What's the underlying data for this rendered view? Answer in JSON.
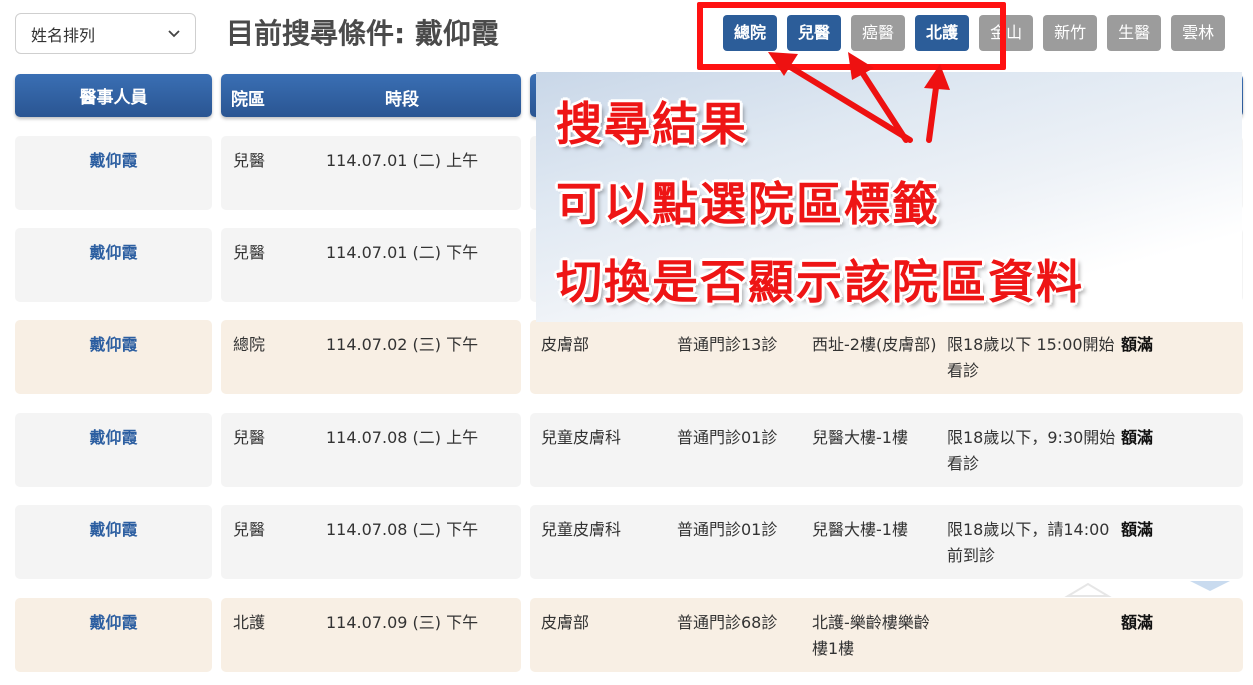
{
  "sort": {
    "label": "姓名排列"
  },
  "title": "目前搜尋條件: 戴仰霞",
  "branch_tags": [
    {
      "label": "總院",
      "active": true
    },
    {
      "label": "兒醫",
      "active": true
    },
    {
      "label": "癌醫",
      "active": false
    },
    {
      "label": "北護",
      "active": true
    },
    {
      "label": "金山",
      "active": false
    },
    {
      "label": "新竹",
      "active": false
    },
    {
      "label": "生醫",
      "active": false
    },
    {
      "label": "雲林",
      "active": false
    }
  ],
  "headers": {
    "staff": "醫事人員",
    "branch": "院區",
    "time": "時段"
  },
  "rows": [
    {
      "staff": "戴仰霞",
      "branch": "兒醫",
      "time": "114.07.01 (二) 上午",
      "dept": "",
      "clinic": "",
      "location": "",
      "note": "",
      "status": ""
    },
    {
      "staff": "戴仰霞",
      "branch": "兒醫",
      "time": "114.07.01 (二) 下午",
      "dept": "",
      "clinic": "",
      "location": "",
      "note": "",
      "status": ""
    },
    {
      "staff": "戴仰霞",
      "branch": "總院",
      "time": "114.07.02 (三) 下午",
      "dept": "皮膚部",
      "clinic": "普通門診13診",
      "location": "西址-2樓(皮膚部)",
      "note": "限18歲以下 15:00開始看診",
      "status": "額滿"
    },
    {
      "staff": "戴仰霞",
      "branch": "兒醫",
      "time": "114.07.08 (二) 上午",
      "dept": "兒童皮膚科",
      "clinic": "普通門診01診",
      "location": "兒醫大樓-1樓",
      "note": "限18歲以下，9:30開始看診",
      "status": "額滿"
    },
    {
      "staff": "戴仰霞",
      "branch": "兒醫",
      "time": "114.07.08 (二) 下午",
      "dept": "兒童皮膚科",
      "clinic": "普通門診01診",
      "location": "兒醫大樓-1樓",
      "note": "限18歲以下，請14:00前到診",
      "status": "額滿"
    },
    {
      "staff": "戴仰霞",
      "branch": "北護",
      "time": "114.07.09 (三) 下午",
      "dept": "皮膚部",
      "clinic": "普通門診68診",
      "location": "北護-樂齡樓樂齡樓1樓",
      "note": "",
      "status": "額滿"
    }
  ],
  "annotation": {
    "lines": [
      "搜尋結果",
      "可以點選院區標籤",
      "切換是否顯示該院區資料"
    ],
    "color": "#ee1515"
  },
  "colors": {
    "active_tag": "#2c5d99",
    "inactive_tag": "#9c9c9c",
    "header": "#2f5f9f",
    "row_gray": "#f4f4f4",
    "row_beige": "#f8efe4"
  }
}
